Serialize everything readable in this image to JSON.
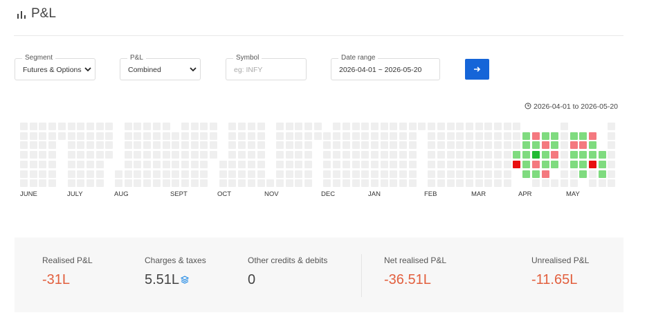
{
  "header": {
    "title": "P&L",
    "icon": "bar-chart-icon"
  },
  "filters": {
    "segment": {
      "label": "Segment",
      "value": "Futures & Options"
    },
    "pnl": {
      "label": "P&L",
      "value": "Combined"
    },
    "symbol": {
      "label": "Symbol",
      "placeholder": "eg: INFY",
      "value": ""
    },
    "date_range": {
      "label": "Date range",
      "value": "2026-04-01 ~ 2026-05-20"
    },
    "submit_icon": "arrow-right-icon"
  },
  "heatmap": {
    "range_text": "2026-04-01 to 2026-05-20",
    "colors": {
      "empty": "#efefef",
      "profit_light": "#7fdb7f",
      "profit_dark": "#22bb33",
      "loss_light": "#f4797f",
      "loss_dark": "#e81010"
    },
    "months": [
      "JUNE",
      "JULY",
      "AUG",
      "SEPT",
      "OCT",
      "NOV",
      "DEC",
      "JAN",
      "FEB",
      "MAR",
      "APR",
      "MAY"
    ]
  },
  "summary": {
    "realised": {
      "label": "Realised P&L",
      "value": "-31L"
    },
    "charges": {
      "label": "Charges & taxes",
      "value": "5.51L"
    },
    "other": {
      "label": "Other credits & debits",
      "value": "0"
    },
    "net": {
      "label": "Net realised P&L",
      "value": "-36.51L"
    },
    "unrealised": {
      "label": "Unrealised P&L",
      "value": "-11.65L"
    }
  }
}
